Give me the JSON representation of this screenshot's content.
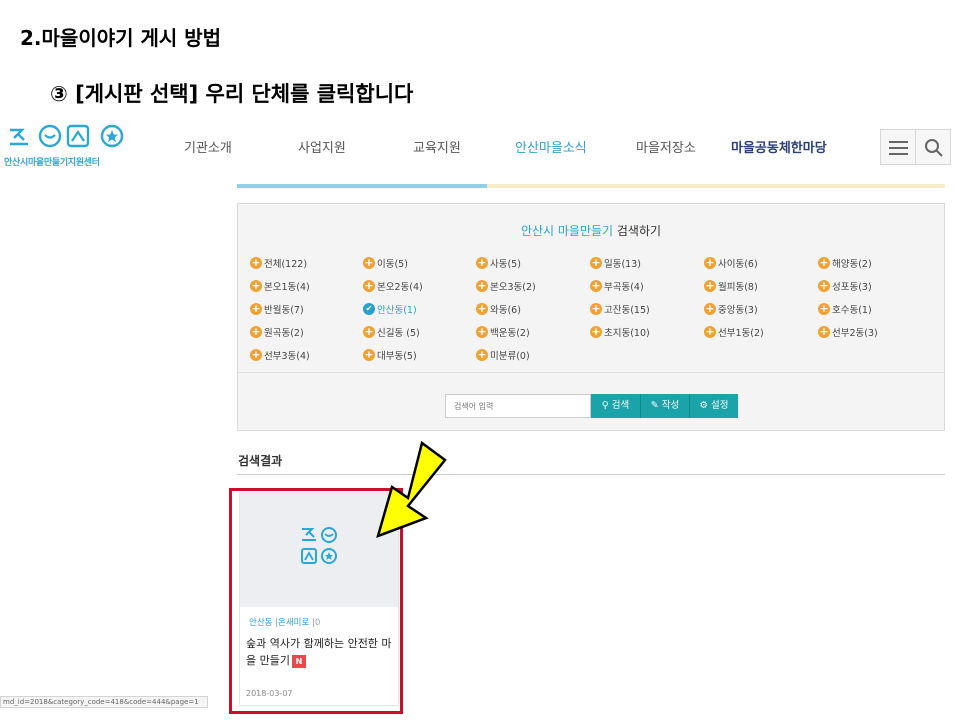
{
  "slide": {
    "title": "2.마을이야기 게시 방법",
    "subtitle": "③ [게시판 선택] 우리 단체를 클릭합니다"
  },
  "site": {
    "logo_text": "안산시마을만들기지원센터",
    "nav": [
      {
        "label": "기관소개",
        "state": "normal"
      },
      {
        "label": "사업지원",
        "state": "normal"
      },
      {
        "label": "교육지원",
        "state": "normal"
      },
      {
        "label": "안산마을소식",
        "state": "active"
      },
      {
        "label": "마을저장소",
        "state": "normal"
      },
      {
        "label": "마을공동체한마당",
        "state": "bold"
      }
    ],
    "colors": {
      "accent": "#2aa3cf",
      "teal_button": "#1aa3a8",
      "orange_dot": "#f0a132",
      "highlight": "#c8102e",
      "arrow": "#ffff00"
    }
  },
  "search_panel": {
    "title_highlight": "안산시 마을만들기",
    "title_rest": " 검색하기",
    "categories": [
      {
        "label": "전체(122)",
        "selected": false
      },
      {
        "label": "이동(5)",
        "selected": false
      },
      {
        "label": "사동(5)",
        "selected": false
      },
      {
        "label": "일동(13)",
        "selected": false
      },
      {
        "label": "사이동(6)",
        "selected": false
      },
      {
        "label": "해양동(2)",
        "selected": false
      },
      {
        "label": "본오1동(4)",
        "selected": false
      },
      {
        "label": "본오2동(4)",
        "selected": false
      },
      {
        "label": "본오3동(2)",
        "selected": false
      },
      {
        "label": "부곡동(4)",
        "selected": false
      },
      {
        "label": "월피동(8)",
        "selected": false
      },
      {
        "label": "성포동(3)",
        "selected": false
      },
      {
        "label": "반월동(7)",
        "selected": false
      },
      {
        "label": "안산동(1)",
        "selected": true
      },
      {
        "label": "와동(6)",
        "selected": false
      },
      {
        "label": "고잔동(15)",
        "selected": false
      },
      {
        "label": "중앙동(3)",
        "selected": false
      },
      {
        "label": "호수동(1)",
        "selected": false
      },
      {
        "label": "원곡동(2)",
        "selected": false
      },
      {
        "label": "신길동 (5)",
        "selected": false
      },
      {
        "label": "백운동(2)",
        "selected": false
      },
      {
        "label": "초지동(10)",
        "selected": false
      },
      {
        "label": "선부1동(2)",
        "selected": false
      },
      {
        "label": "선부2동(3)",
        "selected": false
      },
      {
        "label": "선부3동(4)",
        "selected": false
      },
      {
        "label": "대부동(5)",
        "selected": false
      },
      {
        "label": "미분류(0)",
        "selected": false
      }
    ],
    "search_placeholder": "검색어 입력",
    "search_button": "검색",
    "write_button": "작성",
    "settings_button": "설정"
  },
  "results": {
    "label": "검색결과",
    "card": {
      "area": "안산동",
      "org": "온새미로",
      "count": "0",
      "title": "숲과 역사가 함께하는 안전한 마을 만들기",
      "badge": "N",
      "date": "2018-03-07"
    }
  },
  "status_url": "md_id=2018&category_code=418&code=444&page=1"
}
